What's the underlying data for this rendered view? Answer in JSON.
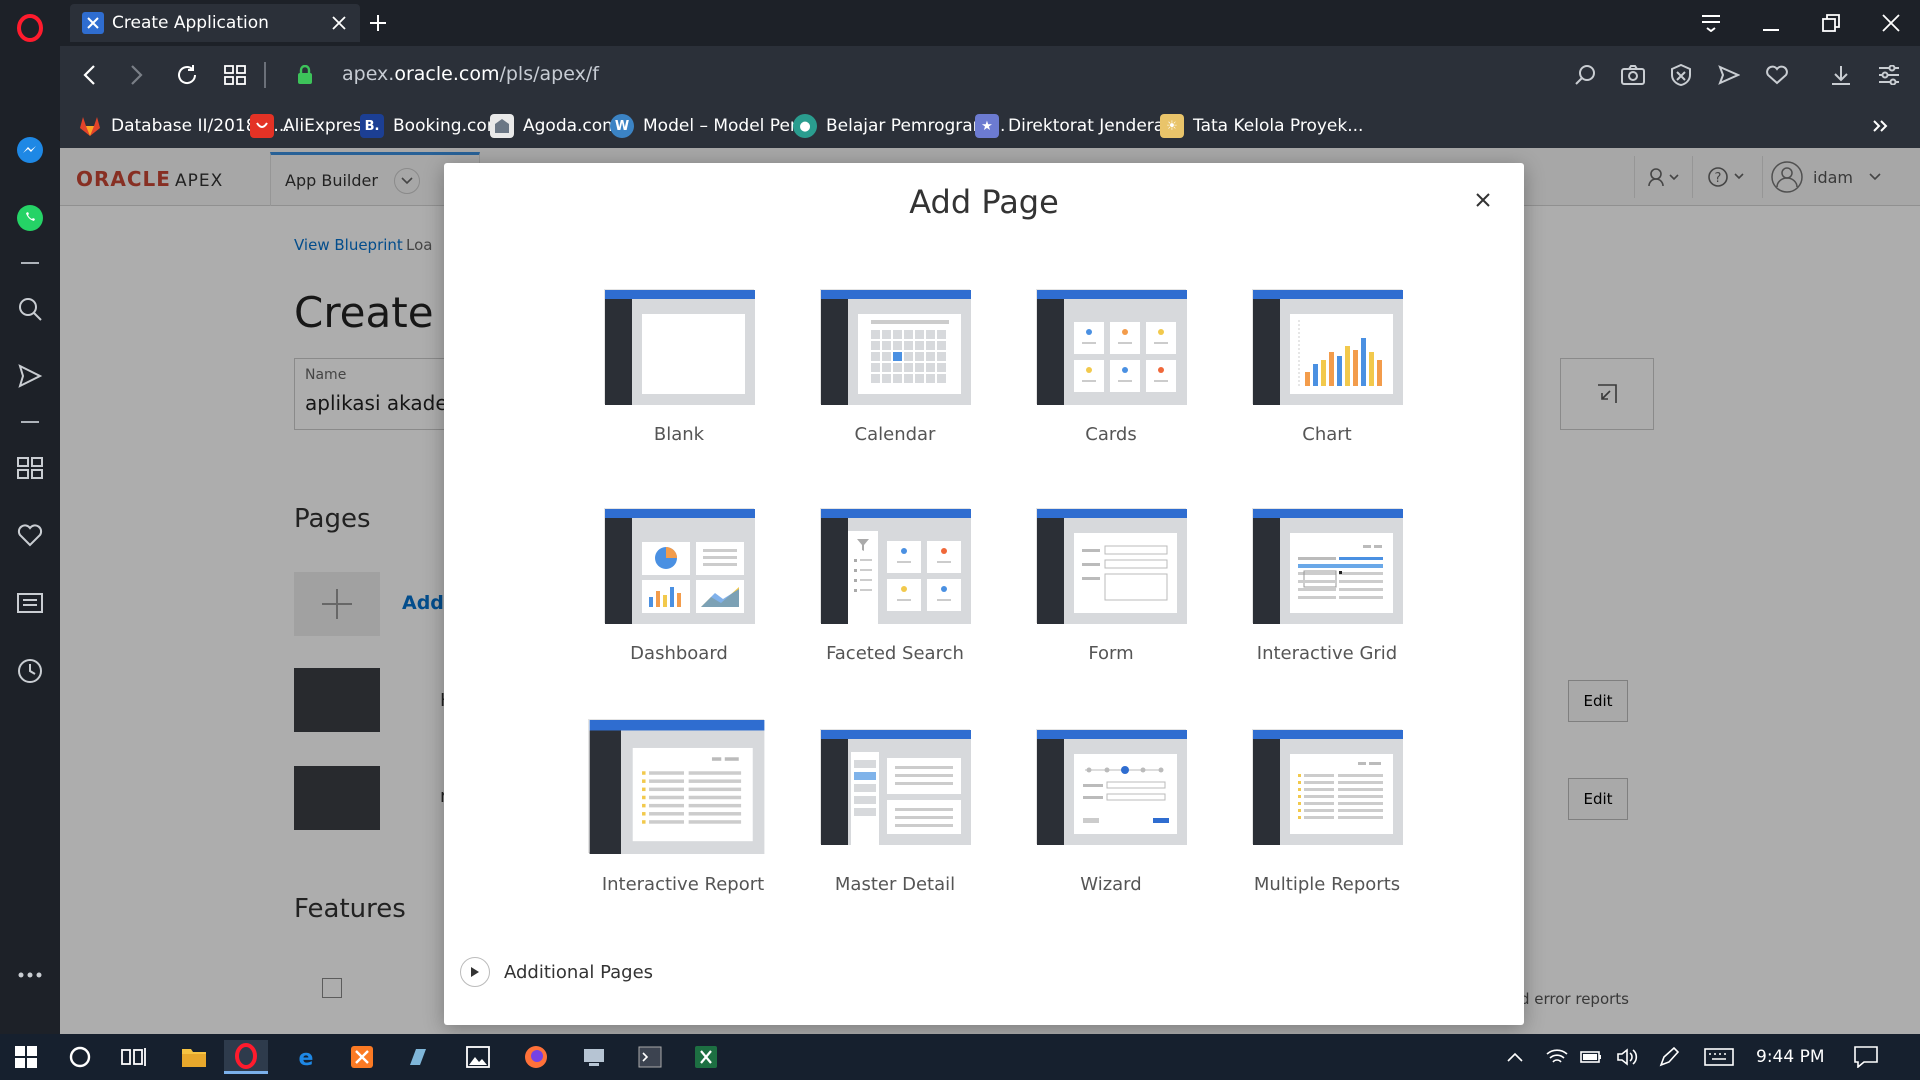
{
  "browser": {
    "tab_title": "Create Application",
    "url_prefix": "apex.",
    "url_domain": "oracle.com",
    "url_path": "/pls/apex/f",
    "bookmarks": [
      {
        "label": "Database II/2018/K...",
        "icon": "gitlab-icon",
        "color": "#e2432a"
      },
      {
        "label": "AliExpress",
        "icon": "aliexpress-icon",
        "color": "#e43225"
      },
      {
        "label": "Booking.com",
        "icon": "booking-icon",
        "color": "#1c3f94"
      },
      {
        "label": "Agoda.com",
        "icon": "agoda-icon",
        "color": "#5b6b7a"
      },
      {
        "label": "Model – Model Pen...",
        "icon": "wordpress-icon",
        "color": "#3b83c4"
      },
      {
        "label": "Belajar Pemrogram...",
        "icon": "site-icon",
        "color": "#2a9d8f"
      },
      {
        "label": "Direktorat Jenderal...",
        "icon": "site-icon",
        "color": "#6c7bd1"
      },
      {
        "label": "Tata Kelola Proyek...",
        "icon": "site-icon",
        "color": "#e9c46a"
      }
    ]
  },
  "apex_header": {
    "logo_oracle": "ORACLE",
    "logo_apex": "APEX",
    "app_builder": "App Builder",
    "user": "idam"
  },
  "background": {
    "view_blueprint": "View Blueprint",
    "load_prefix": "Loa",
    "heading_partial": "Create a",
    "name_label": "Name",
    "name_value_partial": "aplikasi akader",
    "pages_heading": "Pages",
    "add_label_partial": "Add",
    "row1_partial": "H",
    "row2_partial": "m",
    "edit_label": "Edit",
    "features_heading": "Features",
    "error_reports_partial": "d error reports"
  },
  "dialog": {
    "title": "Add Page",
    "tiles": [
      {
        "label": "Blank",
        "name": "tile-blank"
      },
      {
        "label": "Calendar",
        "name": "tile-calendar"
      },
      {
        "label": "Cards",
        "name": "tile-cards"
      },
      {
        "label": "Chart",
        "name": "tile-chart"
      },
      {
        "label": "Dashboard",
        "name": "tile-dashboard"
      },
      {
        "label": "Faceted Search",
        "name": "tile-faceted-search"
      },
      {
        "label": "Form",
        "name": "tile-form"
      },
      {
        "label": "Interactive Grid",
        "name": "tile-interactive-grid"
      },
      {
        "label": "Interactive Report",
        "name": "tile-interactive-report"
      },
      {
        "label": "Master Detail",
        "name": "tile-master-detail"
      },
      {
        "label": "Wizard",
        "name": "tile-wizard"
      },
      {
        "label": "Multiple Reports",
        "name": "tile-multiple-reports"
      }
    ],
    "additional_pages": "Additional Pages"
  },
  "taskbar": {
    "time": "9:44 PM"
  },
  "colors": {
    "accent_blue": "#2f6dd0",
    "dark_sidebar": "#2b2f36",
    "oracle_red": "#c74634"
  }
}
